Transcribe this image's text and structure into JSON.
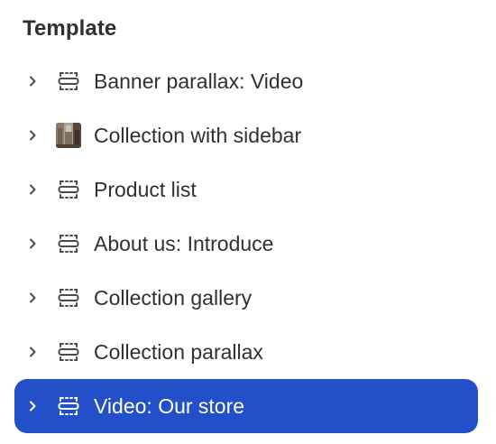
{
  "heading": "Template",
  "colors": {
    "text": "#303030",
    "icon": "#4a4a4a",
    "selected_bg": "#2350c8",
    "selected_text": "#ffffff"
  },
  "sections": [
    {
      "label": "Banner parallax: Video",
      "icon": "section-dashed-icon",
      "selected": false
    },
    {
      "label": "Collection with sidebar",
      "icon": "collection-thumbnail",
      "selected": false
    },
    {
      "label": "Product list",
      "icon": "section-dashed-icon",
      "selected": false
    },
    {
      "label": "About us: Introduce",
      "icon": "section-dashed-icon",
      "selected": false
    },
    {
      "label": "Collection gallery",
      "icon": "section-dashed-icon",
      "selected": false
    },
    {
      "label": "Collection parallax",
      "icon": "section-dashed-icon",
      "selected": false
    },
    {
      "label": "Video: Our store",
      "icon": "section-dashed-icon",
      "selected": true
    }
  ]
}
